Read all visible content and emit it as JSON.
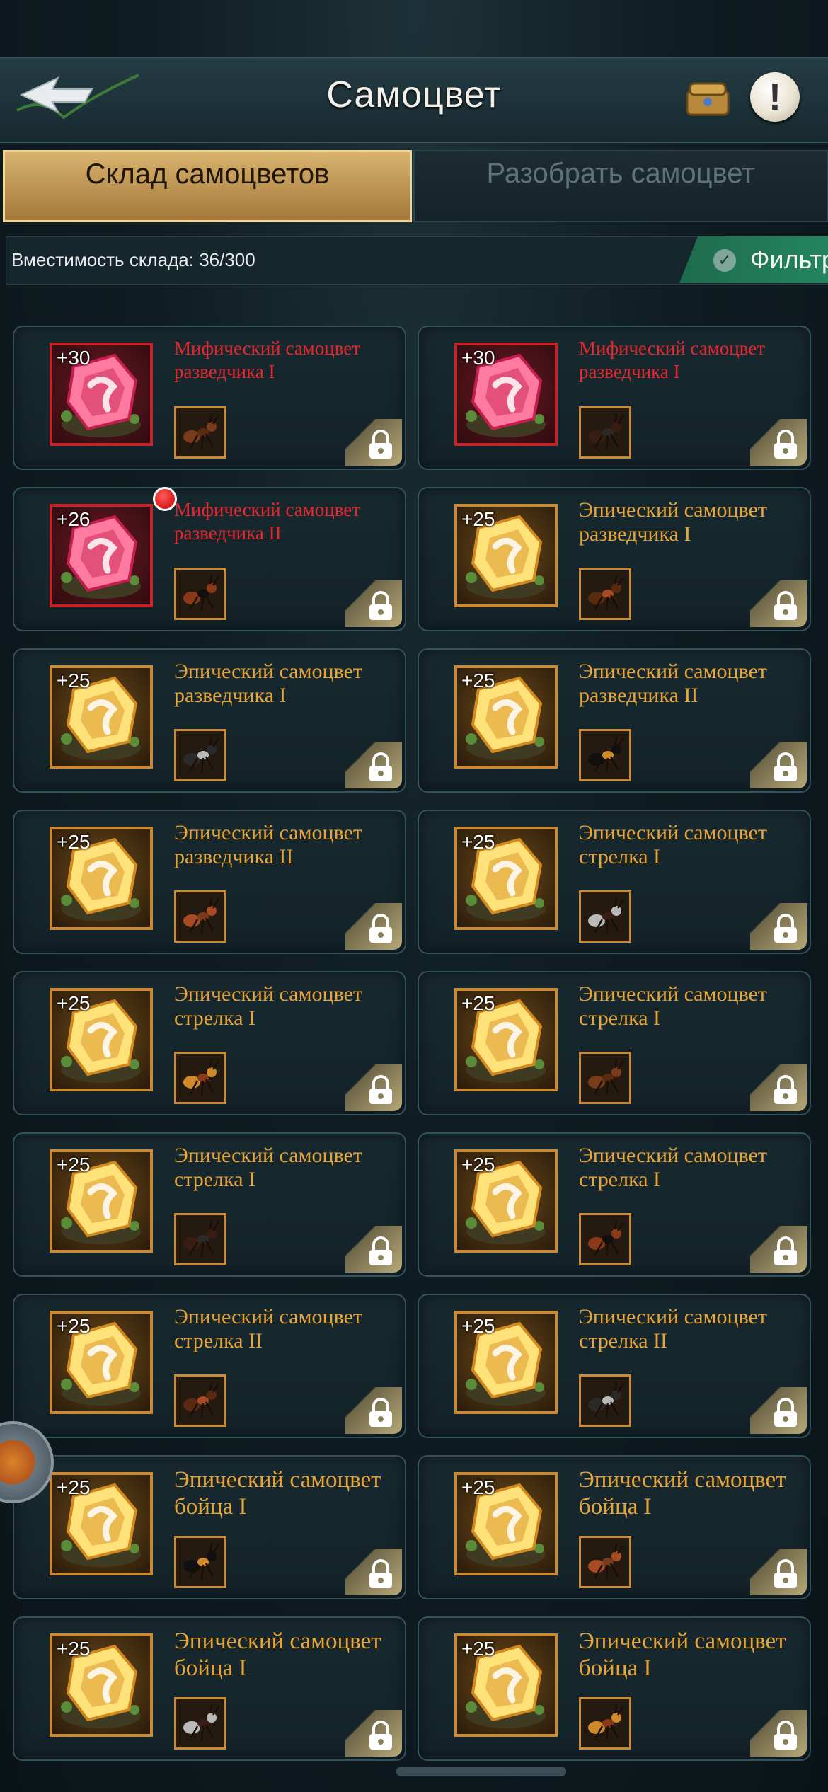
{
  "header": {
    "title": "Самоцвет"
  },
  "tabs": [
    {
      "label": "Склад самоцветов",
      "active": true
    },
    {
      "label": "Разобрать самоцвет",
      "active": false
    }
  ],
  "capacity": {
    "text": "Вместимость склада: 36/300"
  },
  "filter": {
    "label": "Фильтр"
  },
  "colors": {
    "mythic": "#e8262c",
    "epic": "#e8a437",
    "active_tab": "#d8b36e",
    "filter": "#238560"
  },
  "gems": [
    {
      "level": "+30",
      "name": "Мифический самоцвет разведчика I",
      "rarity": "mythic",
      "new": false
    },
    {
      "level": "+30",
      "name": "Мифический самоцвет разведчика I",
      "rarity": "mythic",
      "new": false
    },
    {
      "level": "+26",
      "name": "Мифический самоцвет разведчика II",
      "rarity": "mythic",
      "new": true
    },
    {
      "level": "+25",
      "name": "Эпический самоцвет разведчика I",
      "rarity": "epic",
      "new": false
    },
    {
      "level": "+25",
      "name": "Эпический самоцвет разведчика I",
      "rarity": "epic",
      "new": false
    },
    {
      "level": "+25",
      "name": "Эпический самоцвет разведчика II",
      "rarity": "epic",
      "new": false
    },
    {
      "level": "+25",
      "name": "Эпический самоцвет разведчика II",
      "rarity": "epic",
      "new": false
    },
    {
      "level": "+25",
      "name": "Эпический самоцвет стрелка I",
      "rarity": "epic",
      "new": false
    },
    {
      "level": "+25",
      "name": "Эпический самоцвет стрелка I",
      "rarity": "epic",
      "new": false
    },
    {
      "level": "+25",
      "name": "Эпический самоцвет стрелка I",
      "rarity": "epic",
      "new": false
    },
    {
      "level": "+25",
      "name": "Эпический самоцвет стрелка I",
      "rarity": "epic",
      "new": false
    },
    {
      "level": "+25",
      "name": "Эпический самоцвет стрелка I",
      "rarity": "epic",
      "new": false
    },
    {
      "level": "+25",
      "name": "Эпический самоцвет стрелка II",
      "rarity": "epic",
      "new": false
    },
    {
      "level": "+25",
      "name": "Эпический самоцвет стрелка II",
      "rarity": "epic",
      "new": false
    },
    {
      "level": "+25",
      "name": "Эпический самоцвет бойца I",
      "rarity": "epic",
      "new": false
    },
    {
      "level": "+25",
      "name": "Эпический самоцвет бойца I",
      "rarity": "epic",
      "new": false
    },
    {
      "level": "+25",
      "name": "Эпический самоцвет бойца I",
      "rarity": "epic",
      "new": false
    },
    {
      "level": "+25",
      "name": "Эпический самоцвет бойца I",
      "rarity": "epic",
      "new": false
    }
  ]
}
